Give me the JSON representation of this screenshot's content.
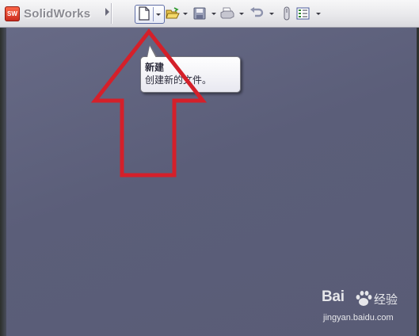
{
  "app": {
    "logo_badge": "SW",
    "logo_text": "SolidWorks"
  },
  "toolbar": {
    "buttons": [
      {
        "name": "new",
        "icon": "new-document-icon",
        "active": true
      },
      {
        "name": "open",
        "icon": "open-folder-icon"
      },
      {
        "name": "save",
        "icon": "save-icon"
      },
      {
        "name": "print",
        "icon": "print-icon"
      },
      {
        "name": "undo",
        "icon": "undo-icon"
      },
      {
        "name": "select",
        "icon": "select-pointer-icon"
      },
      {
        "name": "options",
        "icon": "options-list-icon"
      }
    ]
  },
  "tooltip": {
    "title": "新建",
    "description": "创建新的文件。"
  },
  "annotation": {
    "shape": "up-arrow-outline",
    "color": "#d4202a"
  },
  "watermark": {
    "brand": "Bai",
    "brand_suffix": "经验",
    "url": "jingyan.baidu.com"
  },
  "colors": {
    "workspace": "#5c5f7a",
    "toolbar": "#e9e9ec",
    "accent_red": "#d4202a"
  }
}
